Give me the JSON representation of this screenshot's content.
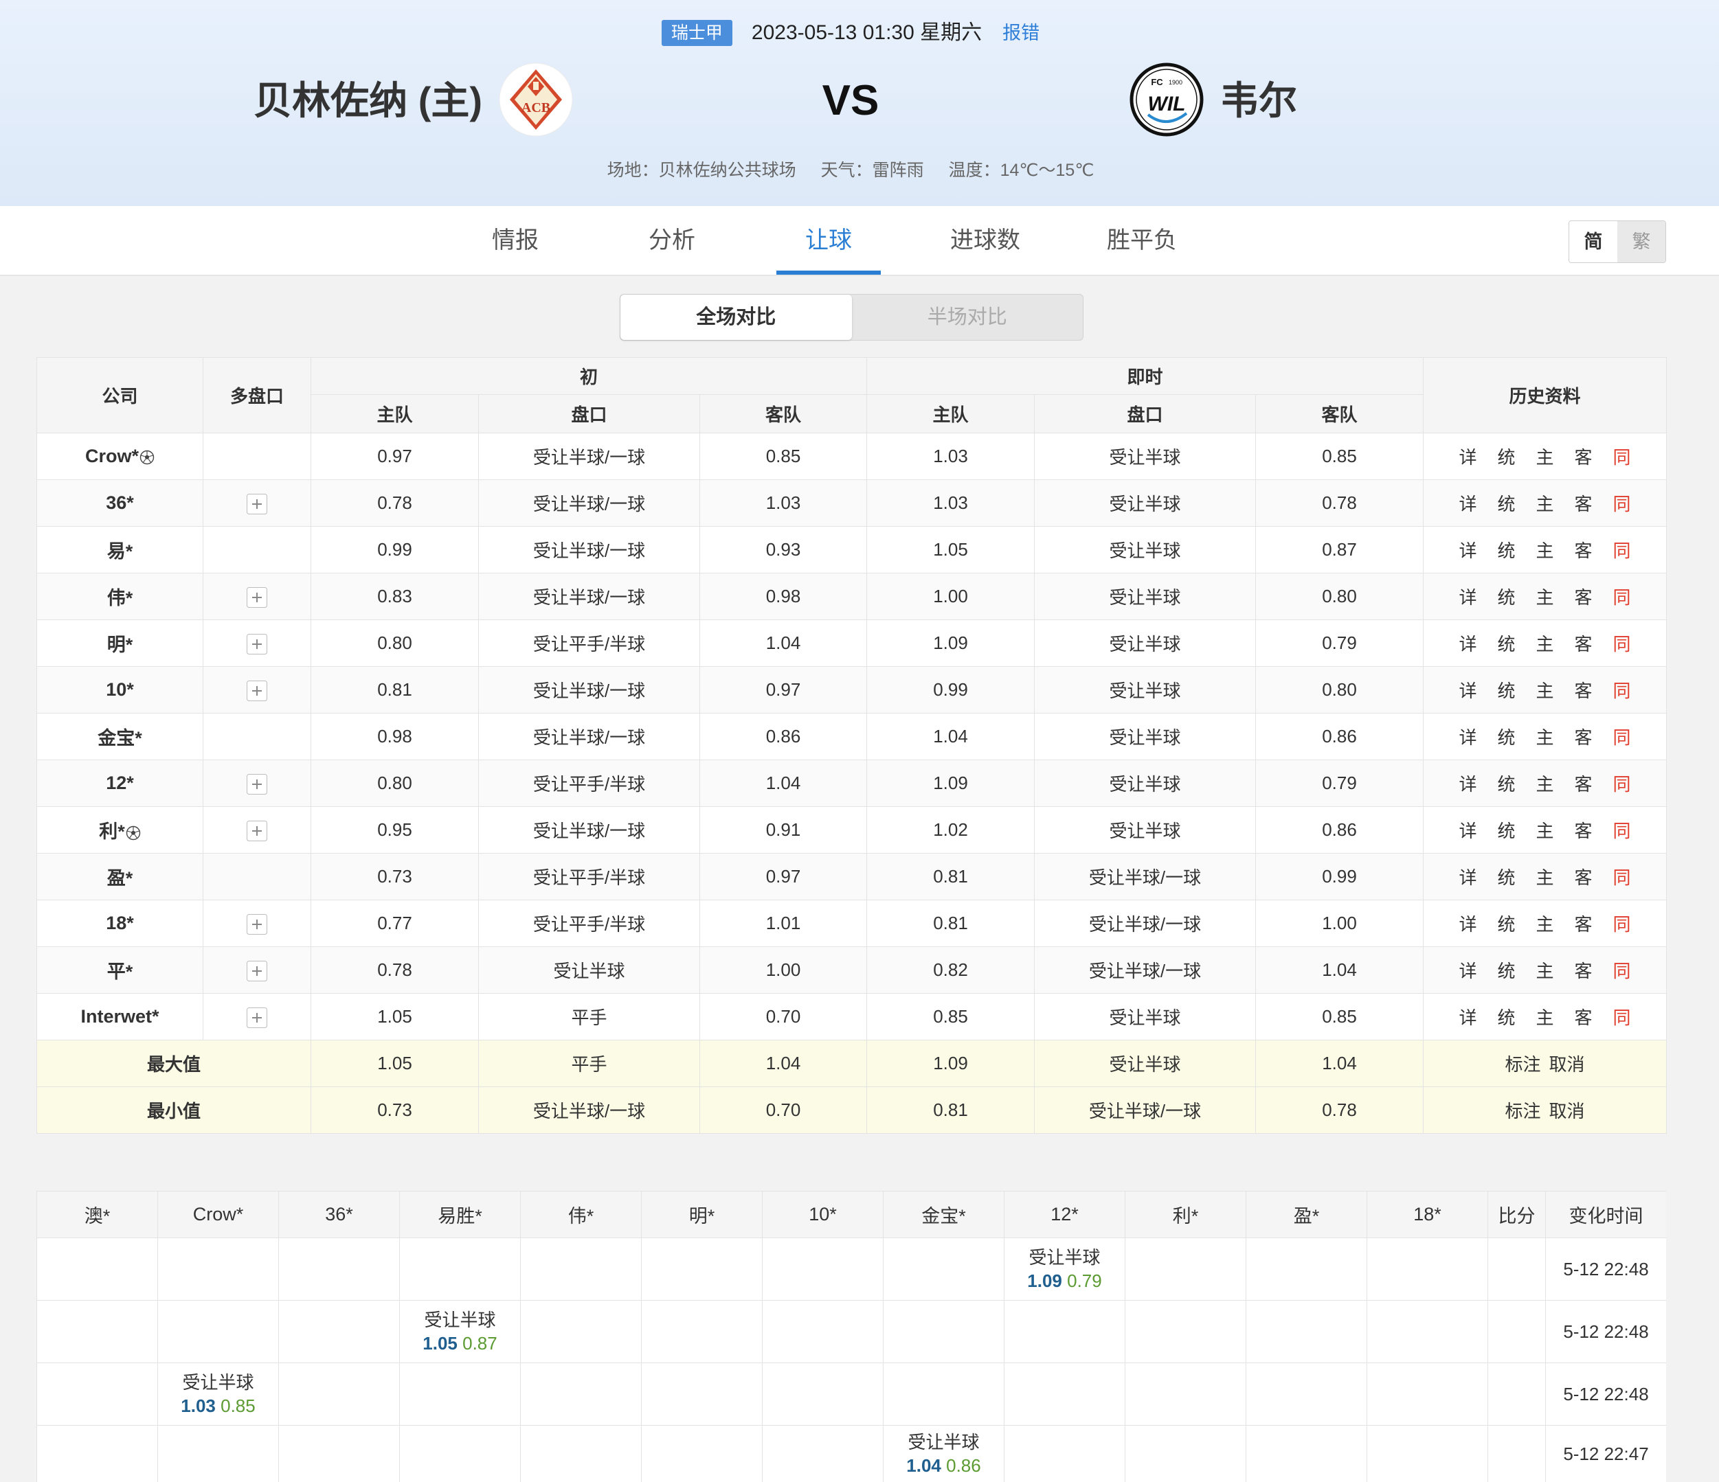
{
  "header": {
    "league": "瑞士甲",
    "datetime": "2023-05-13 01:30 星期六",
    "report_label": "报错",
    "home_team": "贝林佐纳 (主)",
    "away_team": "韦尔",
    "vs_label": "VS",
    "home_logo": {
      "icon": "acb-bellinzona-crest-icon",
      "lettering": "ACB"
    },
    "away_logo": {
      "icon": "fc-wil-1900-crest-icon",
      "lettering_top_left": "FC",
      "lettering_top_right": "1900",
      "lettering_main": "WIL"
    },
    "venue": "场地：贝林佐纳公共球场",
    "weather": "天气：雷阵雨",
    "temperature": "温度：14℃～15℃"
  },
  "nav": {
    "tabs": [
      {
        "label": "情报"
      },
      {
        "label": "分析"
      },
      {
        "label": "让球",
        "active": true
      },
      {
        "label": "进球数"
      },
      {
        "label": "胜平负"
      }
    ],
    "script_toggle": {
      "simplified": "简",
      "traditional": "繁",
      "active": "简"
    }
  },
  "compare_toggle": {
    "full": "全场对比",
    "half": "半场对比",
    "active": "全场对比"
  },
  "odds_table": {
    "headers": {
      "company": "公司",
      "multi": "多盘口",
      "initial": "初",
      "live": "即时",
      "history": "历史资料",
      "home": "主队",
      "line": "盘口",
      "away": "客队"
    },
    "history_links": [
      {
        "label": "详"
      },
      {
        "label": "统"
      },
      {
        "label": "主"
      },
      {
        "label": "客"
      },
      {
        "label": "同",
        "highlight": true
      }
    ],
    "rows": [
      {
        "company": "Crow*",
        "ball_icon": true,
        "multi_toggle": false,
        "initial": [
          "0.97",
          "受让半球/一球",
          "0.85"
        ],
        "live": [
          "1.03",
          "受让半球",
          "0.85"
        ]
      },
      {
        "company": "36*",
        "ball_icon": false,
        "multi_toggle": true,
        "initial": [
          "0.78",
          "受让半球/一球",
          "1.03"
        ],
        "live": [
          "1.03",
          "受让半球",
          "0.78"
        ]
      },
      {
        "company": "易*",
        "ball_icon": false,
        "multi_toggle": false,
        "initial": [
          "0.99",
          "受让半球/一球",
          "0.93"
        ],
        "live": [
          "1.05",
          "受让半球",
          "0.87"
        ]
      },
      {
        "company": "伟*",
        "ball_icon": false,
        "multi_toggle": true,
        "initial": [
          "0.83",
          "受让半球/一球",
          "0.98"
        ],
        "live": [
          "1.00",
          "受让半球",
          "0.80"
        ]
      },
      {
        "company": "明*",
        "ball_icon": false,
        "multi_toggle": true,
        "initial": [
          "0.80",
          "受让平手/半球",
          "1.04"
        ],
        "live": [
          "1.09",
          "受让半球",
          "0.79"
        ]
      },
      {
        "company": "10*",
        "ball_icon": false,
        "multi_toggle": true,
        "initial": [
          "0.81",
          "受让半球/一球",
          "0.97"
        ],
        "live": [
          "0.99",
          "受让半球",
          "0.80"
        ]
      },
      {
        "company": "金宝*",
        "ball_icon": false,
        "multi_toggle": false,
        "initial": [
          "0.98",
          "受让半球/一球",
          "0.86"
        ],
        "live": [
          "1.04",
          "受让半球",
          "0.86"
        ]
      },
      {
        "company": "12*",
        "ball_icon": false,
        "multi_toggle": true,
        "initial": [
          "0.80",
          "受让平手/半球",
          "1.04"
        ],
        "live": [
          "1.09",
          "受让半球",
          "0.79"
        ]
      },
      {
        "company": "利*",
        "ball_icon": true,
        "multi_toggle": true,
        "initial": [
          "0.95",
          "受让半球/一球",
          "0.91"
        ],
        "live": [
          "1.02",
          "受让半球",
          "0.86"
        ]
      },
      {
        "company": "盈*",
        "ball_icon": false,
        "multi_toggle": false,
        "initial": [
          "0.73",
          "受让平手/半球",
          "0.97"
        ],
        "live": [
          "0.81",
          "受让半球/一球",
          "0.99"
        ]
      },
      {
        "company": "18*",
        "ball_icon": false,
        "multi_toggle": true,
        "initial": [
          "0.77",
          "受让平手/半球",
          "1.01"
        ],
        "live": [
          "0.81",
          "受让半球/一球",
          "1.00"
        ]
      },
      {
        "company": "平*",
        "ball_icon": false,
        "multi_toggle": true,
        "initial": [
          "0.78",
          "受让半球",
          "1.00"
        ],
        "live": [
          "0.82",
          "受让半球/一球",
          "1.04"
        ]
      },
      {
        "company": "Interwet*",
        "ball_icon": false,
        "multi_toggle": true,
        "initial": [
          "1.05",
          "平手",
          "0.70"
        ],
        "live": [
          "0.85",
          "受让半球",
          "0.85"
        ]
      }
    ],
    "summary": [
      {
        "label": "最大值",
        "initial": [
          "1.05",
          "平手",
          "1.04"
        ],
        "live": [
          "1.09",
          "受让半球",
          "1.04"
        ]
      },
      {
        "label": "最小值",
        "initial": [
          "0.73",
          "受让半球/一球",
          "0.70"
        ],
        "live": [
          "0.81",
          "受让半球/一球",
          "0.78"
        ]
      }
    ],
    "summary_actions": [
      "标注",
      "取消"
    ]
  },
  "changes_table": {
    "headers": [
      "澳*",
      "Crow*",
      "36*",
      "易胜*",
      "伟*",
      "明*",
      "10*",
      "金宝*",
      "12*",
      "利*",
      "盈*",
      "18*",
      "比分",
      "变化时间"
    ],
    "rows": [
      {
        "company": "12*",
        "handicap": "受让半球",
        "home": "1.09",
        "away": "0.79",
        "time": "5-12 22:48"
      },
      {
        "company": "易胜*",
        "handicap": "受让半球",
        "home": "1.05",
        "away": "0.87",
        "time": "5-12 22:48"
      },
      {
        "company": "Crow*",
        "handicap": "受让半球",
        "home": "1.03",
        "away": "0.85",
        "time": "5-12 22:48"
      },
      {
        "company": "金宝*",
        "handicap": "受让半球",
        "home": "1.04",
        "away": "0.86",
        "time": "5-12 22:47"
      }
    ]
  },
  "colors": {
    "accent": "#2a7fd4",
    "league_badge": "#4b8fdc",
    "home_odds": "#1f5f8f",
    "away_odds": "#5b9b32",
    "history_highlight": "#e03c2c",
    "summary_row_bg": "#fbfbe6"
  }
}
